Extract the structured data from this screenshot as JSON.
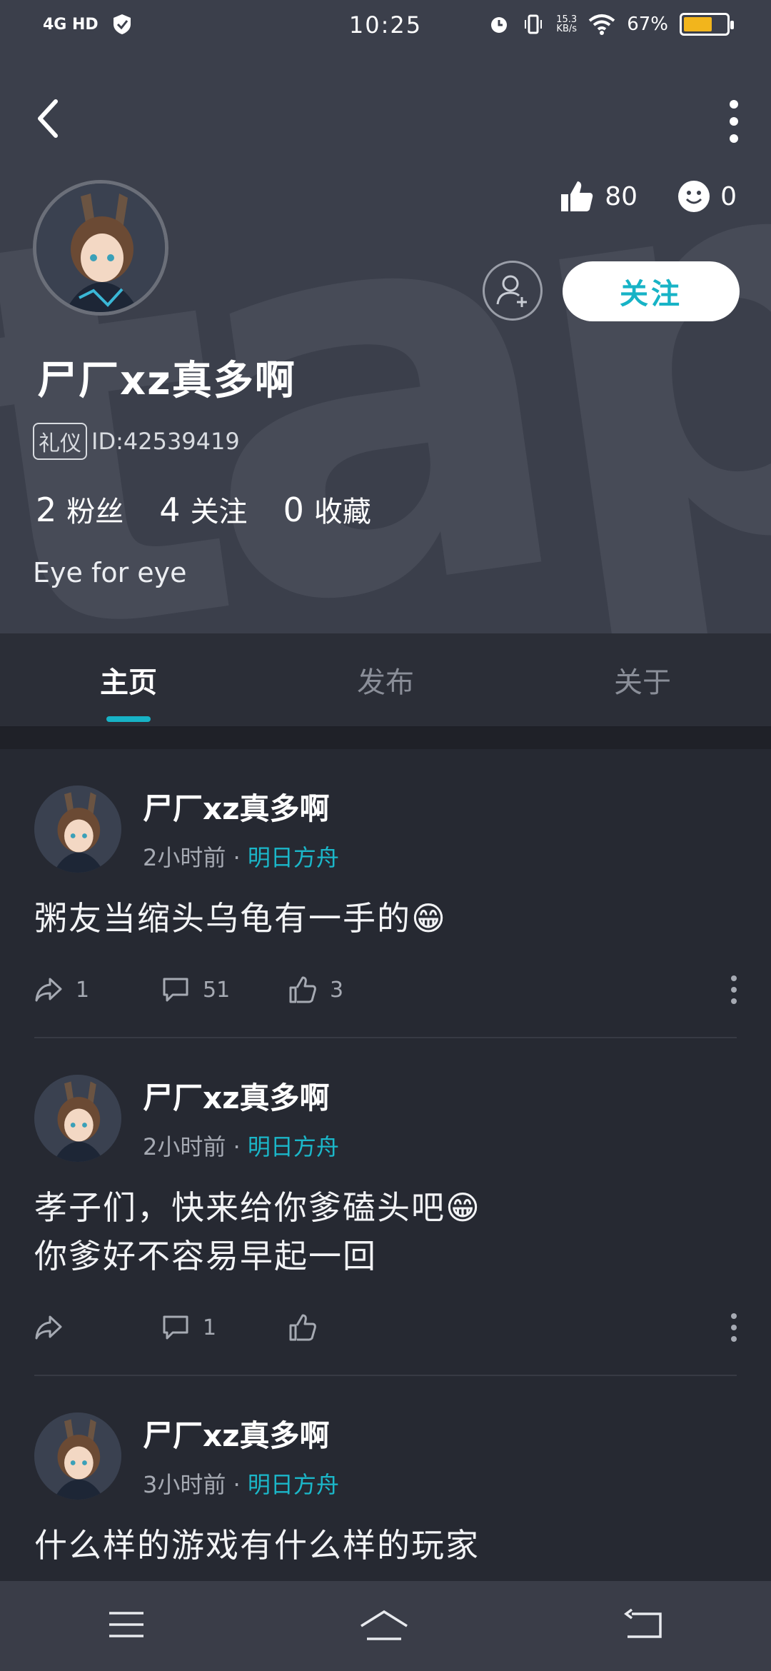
{
  "status_bar": {
    "network": "4G HD",
    "time": "10:25",
    "speed_value": "15.3",
    "speed_unit": "KB/s",
    "battery": "67%",
    "battery_level": 0.67
  },
  "watermark": "tapTap",
  "profile": {
    "likes": "80",
    "emotes": "0",
    "follow_label": "关注",
    "username": "尸厂xz真多啊",
    "badge": "礼仪",
    "id_text": "ID:42539419",
    "fans_count": "2",
    "fans_label": "粉丝",
    "following_count": "4",
    "following_label": "关注",
    "favorites_count": "0",
    "favorites_label": "收藏",
    "bio": "Eye for eye"
  },
  "tabs": [
    {
      "label": "主页",
      "active": true
    },
    {
      "label": "发布",
      "active": false
    },
    {
      "label": "关于",
      "active": false
    }
  ],
  "posts": [
    {
      "author": "尸厂xz真多啊",
      "time": "2小时前",
      "separator": "·",
      "game": "明日方舟",
      "body_lines": [
        "粥友当缩头乌龟有一手的😁"
      ],
      "shares": "1",
      "comments": "51",
      "likes": "3"
    },
    {
      "author": "尸厂xz真多啊",
      "time": "2小时前",
      "separator": "·",
      "game": "明日方舟",
      "body_lines": [
        "孝子们，快来给你爹磕头吧😁",
        "你爹好不容易早起一回"
      ],
      "shares": "",
      "comments": "1",
      "likes": ""
    },
    {
      "author": "尸厂xz真多啊",
      "time": "3小时前",
      "separator": "·",
      "game": "明日方舟",
      "body_lines": [
        "什么样的游戏有什么样的玩家"
      ],
      "shares": "",
      "comments": "",
      "likes": ""
    }
  ],
  "colors": {
    "accent": "#17b3c6",
    "header_bg": "#3b3f4b",
    "feed_bg": "#262932"
  }
}
